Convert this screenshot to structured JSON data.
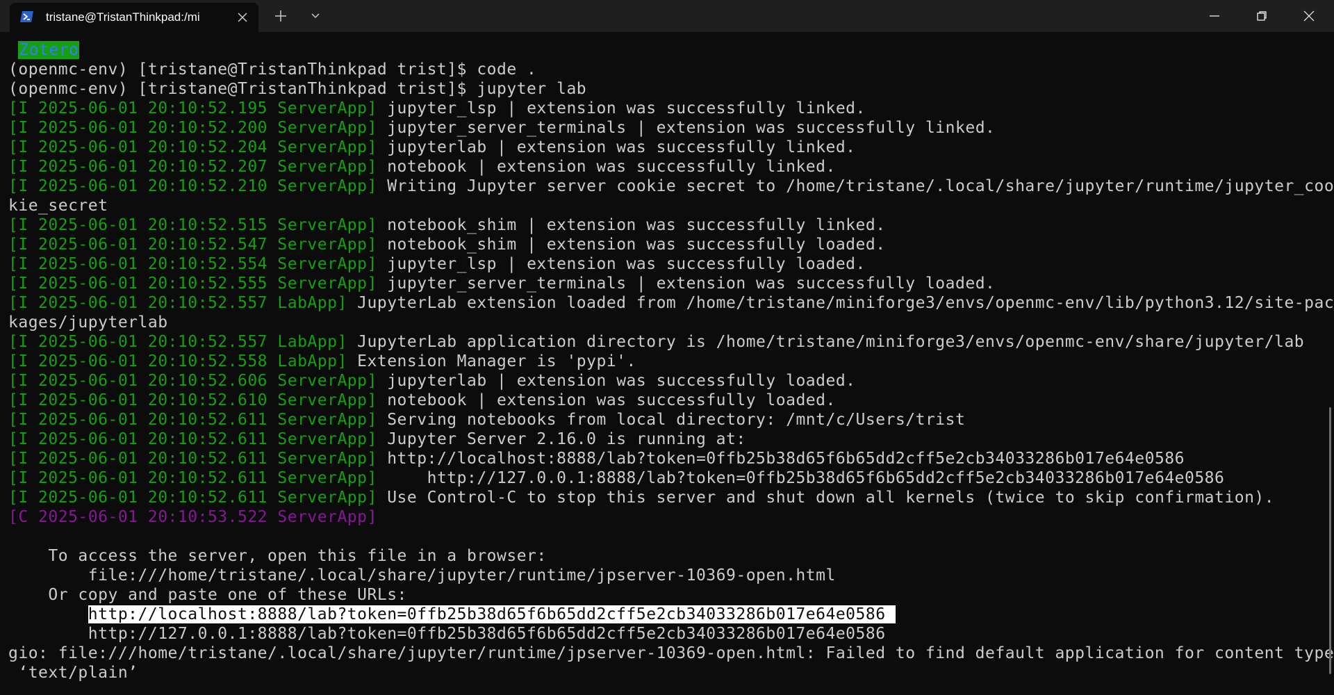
{
  "window": {
    "tab_title": "tristane@TristanThinkpad:/mi",
    "tab_icon": "powershell-icon"
  },
  "colors": {
    "background": "#0c0c0c",
    "titlebar": "#1f1f1f",
    "text": "#cccccc",
    "green": "#13a10e",
    "magenta": "#881798"
  },
  "terminal": {
    "zotero_badge": "Zotero",
    "line2": "(openmc-env) [tristane@TristanThinkpad trist]$ code .",
    "line3": "(openmc-env) [tristane@TristanThinkpad trist]$ jupyter lab",
    "logs": [
      {
        "prefix": "[I 2025-06-01 20:10:52.195 ServerApp]",
        "msg": " jupyter_lsp | extension was successfully linked."
      },
      {
        "prefix": "[I 2025-06-01 20:10:52.200 ServerApp]",
        "msg": " jupyter_server_terminals | extension was successfully linked."
      },
      {
        "prefix": "[I 2025-06-01 20:10:52.204 ServerApp]",
        "msg": " jupyterlab | extension was successfully linked."
      },
      {
        "prefix": "[I 2025-06-01 20:10:52.207 ServerApp]",
        "msg": " notebook | extension was successfully linked."
      },
      {
        "prefix": "[I 2025-06-01 20:10:52.210 ServerApp]",
        "msg": " Writing Jupyter server cookie secret to /home/tristane/.local/share/jupyter/runtime/jupyter_coo"
      },
      {
        "prefix": "",
        "msg": "kie_secret"
      },
      {
        "prefix": "[I 2025-06-01 20:10:52.515 ServerApp]",
        "msg": " notebook_shim | extension was successfully linked."
      },
      {
        "prefix": "[I 2025-06-01 20:10:52.547 ServerApp]",
        "msg": " notebook_shim | extension was successfully loaded."
      },
      {
        "prefix": "[I 2025-06-01 20:10:52.554 ServerApp]",
        "msg": " jupyter_lsp | extension was successfully loaded."
      },
      {
        "prefix": "[I 2025-06-01 20:10:52.555 ServerApp]",
        "msg": " jupyter_server_terminals | extension was successfully loaded."
      },
      {
        "prefix": "[I 2025-06-01 20:10:52.557 LabApp]",
        "msg": " JupyterLab extension loaded from /home/tristane/miniforge3/envs/openmc-env/lib/python3.12/site-pac"
      },
      {
        "prefix": "",
        "msg": "kages/jupyterlab"
      },
      {
        "prefix": "[I 2025-06-01 20:10:52.557 LabApp]",
        "msg": " JupyterLab application directory is /home/tristane/miniforge3/envs/openmc-env/share/jupyter/lab"
      },
      {
        "prefix": "[I 2025-06-01 20:10:52.558 LabApp]",
        "msg": " Extension Manager is 'pypi'."
      },
      {
        "prefix": "[I 2025-06-01 20:10:52.606 ServerApp]",
        "msg": " jupyterlab | extension was successfully loaded."
      },
      {
        "prefix": "[I 2025-06-01 20:10:52.610 ServerApp]",
        "msg": " notebook | extension was successfully loaded."
      },
      {
        "prefix": "[I 2025-06-01 20:10:52.611 ServerApp]",
        "msg": " Serving notebooks from local directory: /mnt/c/Users/trist"
      },
      {
        "prefix": "[I 2025-06-01 20:10:52.611 ServerApp]",
        "msg": " Jupyter Server 2.16.0 is running at:"
      },
      {
        "prefix": "[I 2025-06-01 20:10:52.611 ServerApp]",
        "msg": " http://localhost:8888/lab?token=0ffb25b38d65f6b65dd2cff5e2cb34033286b017e64e0586"
      },
      {
        "prefix": "[I 2025-06-01 20:10:52.611 ServerApp]",
        "msg": "     http://127.0.0.1:8888/lab?token=0ffb25b38d65f6b65dd2cff5e2cb34033286b017e64e0586"
      },
      {
        "prefix": "[I 2025-06-01 20:10:52.611 ServerApp]",
        "msg": " Use Control-C to stop this server and shut down all kernels (twice to skip confirmation)."
      }
    ],
    "critical_prefix": "[C 2025-06-01 20:10:53.522 ServerApp]",
    "access_line": "    To access the server, open this file in a browser:",
    "file_url": "        file:///home/tristane/.local/share/jupyter/runtime/jpserver-10369-open.html",
    "copy_line": "    Or copy and paste one of these URLs:",
    "url_indent": "        ",
    "url_localhost": "http://localhost:8888/lab?token=0ffb25b38d65f6b65dd2cff5e2cb34033286b017e64e0586 ",
    "url_127": "        http://127.0.0.1:8888/lab?token=0ffb25b38d65f6b65dd2cff5e2cb34033286b017e64e0586",
    "gio_line": "gio: file:///home/tristane/.local/share/jupyter/runtime/jpserver-10369-open.html: Failed to find default application for content type",
    "gio_line2": " ‘text/plain’"
  }
}
